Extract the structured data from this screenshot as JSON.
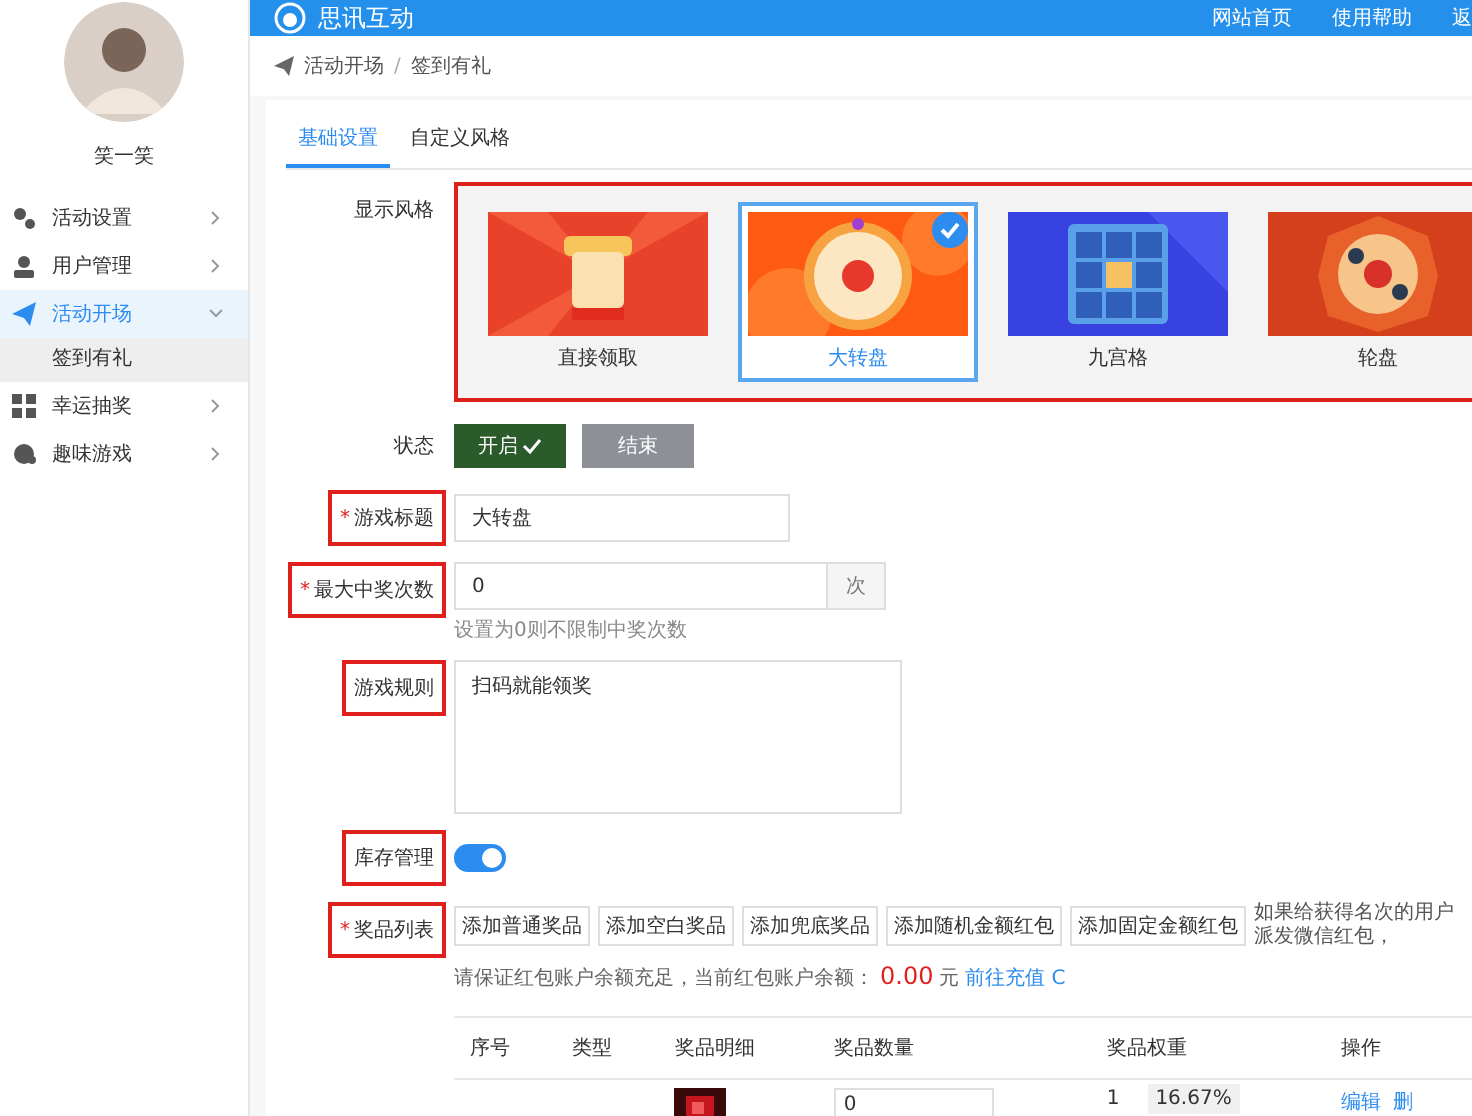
{
  "header": {
    "title": "思讯互动",
    "links": [
      "网站首页",
      "使用帮助",
      "返"
    ]
  },
  "user": {
    "name": "笑一笑"
  },
  "sidebar": {
    "items": [
      {
        "label": "活动设置",
        "expanded": false,
        "selected": false
      },
      {
        "label": "用户管理",
        "expanded": false,
        "selected": false
      },
      {
        "label": "活动开场",
        "expanded": true,
        "selected": true,
        "children": [
          {
            "label": "签到有礼",
            "selected": true
          }
        ]
      },
      {
        "label": "幸运抽奖",
        "expanded": false,
        "selected": false
      },
      {
        "label": "趣味游戏",
        "expanded": false,
        "selected": false
      }
    ]
  },
  "breadcrumb": {
    "separator": "/",
    "items": [
      "活动开场",
      "签到有礼"
    ]
  },
  "tabs": [
    {
      "label": "基础设置",
      "selected": true
    },
    {
      "label": "自定义风格",
      "selected": false
    }
  ],
  "styles": {
    "label": "显示风格",
    "highlighted": true,
    "options": [
      {
        "label": "直接领取",
        "selected": false,
        "kind": "picture"
      },
      {
        "label": "大转盘",
        "selected": true,
        "kind": "picture"
      },
      {
        "label": "九宫格",
        "selected": false,
        "kind": "picture"
      },
      {
        "label": "轮盘",
        "selected": false,
        "kind": "picture"
      }
    ]
  },
  "status": {
    "label": "状态",
    "options": [
      {
        "label": "开启",
        "selected": true
      },
      {
        "label": "结束",
        "selected": false
      }
    ]
  },
  "fields": [
    {
      "kind": "text",
      "label": "游戏标题",
      "required_mark": "*",
      "highlighted": true,
      "value": "大转盘"
    },
    {
      "kind": "addon",
      "label": "最大中奖次数",
      "required_mark": "*",
      "highlighted": true,
      "value": "0",
      "suffix": "次",
      "hint": "设置为0则不限制中奖次数"
    },
    {
      "kind": "textarea",
      "label": "游戏规则",
      "highlighted": true,
      "value": "扫码就能领奖"
    },
    {
      "kind": "switch",
      "label": "库存管理",
      "highlighted": true,
      "on": true
    }
  ],
  "prizes": {
    "label": "奖品列表",
    "required_mark": "*",
    "highlighted": true,
    "buttons": [
      "添加普通奖品",
      "添加空白奖品",
      "添加兜底奖品",
      "添加随机金额红包",
      "添加固定金额红包"
    ],
    "note": "如果给获得名次的用户派发微信红包，",
    "balance_text": "请保证红包账户余额充足，当前红包账户余额：",
    "balance": "0.00",
    "currency": "元",
    "recharge": "前往充值",
    "refresh": "C"
  },
  "table": {
    "columns": [
      "序号",
      "类型",
      "奖品明细",
      "奖品数量",
      "奖品权重",
      "操作"
    ],
    "rows": [
      {
        "quantity": "0",
        "weight": "1",
        "percent": "16.67%",
        "actions": [
          "编辑",
          "删"
        ]
      }
    ]
  }
}
